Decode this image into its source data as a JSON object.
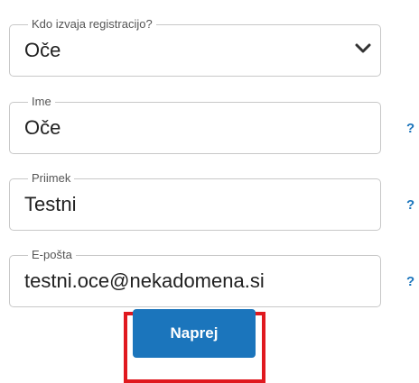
{
  "form": {
    "who_registers": {
      "label": "Kdo izvaja registracijo?",
      "value": "Oče",
      "icon": "chevron-down-icon"
    },
    "first_name": {
      "label": "Ime",
      "value": "Oče",
      "help": "?"
    },
    "last_name": {
      "label": "Priimek",
      "value": "Testni",
      "help": "?"
    },
    "email": {
      "label": "E-pošta",
      "value": "testni.oce@nekadomena.si",
      "help": "?"
    },
    "next_button": "Naprej"
  },
  "colors": {
    "accent": "#1b75bc",
    "highlight": "#e0191f",
    "border": "#c8c8c8"
  }
}
